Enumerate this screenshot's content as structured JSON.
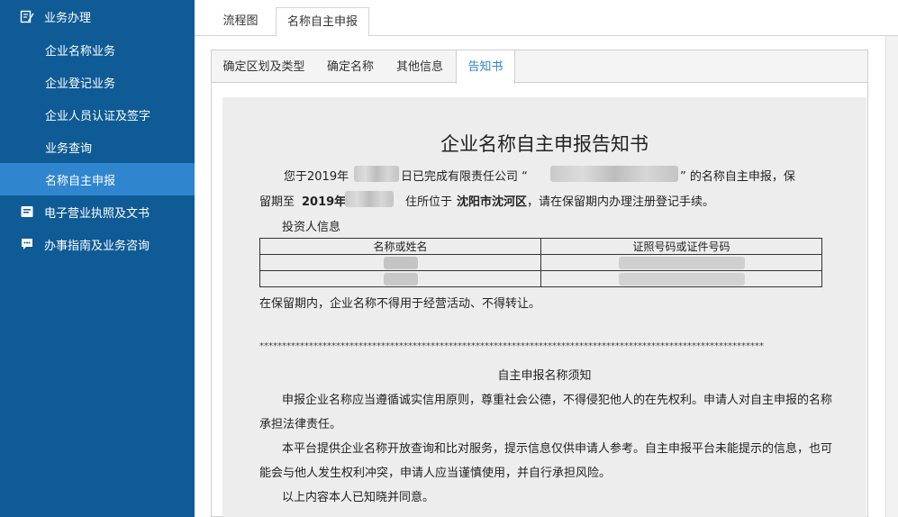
{
  "sidebar": {
    "items": [
      {
        "label": "业务办理",
        "icon": "edit-icon",
        "level": "top"
      },
      {
        "label": "企业名称业务",
        "level": "sub"
      },
      {
        "label": "企业登记业务",
        "level": "sub"
      },
      {
        "label": "企业人员认证及签字",
        "level": "sub"
      },
      {
        "label": "业务查询",
        "level": "sub"
      },
      {
        "label": "名称自主申报",
        "level": "sub",
        "active": true
      },
      {
        "label": "电子营业执照及文书",
        "icon": "license-icon",
        "level": "top"
      },
      {
        "label": "办事指南及业务咨询",
        "icon": "chat-icon",
        "level": "top"
      }
    ]
  },
  "top_tabs": [
    "流程图",
    "名称自主申报"
  ],
  "inner_tabs": [
    "确定区划及类型",
    "确定名称",
    "其他信息",
    "告知书"
  ],
  "notice": {
    "title": "企业名称自主申报告知书",
    "p1_a": "您于2019年",
    "p1_b": "日已完成有限责任公司 “",
    "p1_c": "” 的名称自主申报，保",
    "p2_a": "留期至",
    "p2_b": "2019年",
    "p2_c": "住所位于",
    "p2_d": "沈阳市沈河区",
    "p2_e": "，请在保留期内办理注册登记手续。",
    "investor_label": "投资人信息",
    "table_headers": [
      "名称或姓名",
      "证照号码或证件号码"
    ],
    "restriction": "在保留期内，企业名称不得用于经营活动、不得转让。",
    "separator": "****************************************************************************************************************",
    "sub_title": "自主申报名称须知",
    "para1_l1": "申报企业名称应当遵循诚实信用原则，尊重社会公德，不得侵犯他人的在先权利。申请人对自主申报的名称",
    "para1_l2": "承担法律责任。",
    "para2_l1": "本平台提供企业名称开放查询和比对服务，提示信息仅供申请人参考。自主申报平台未能提示的信息，也可",
    "para2_l2": "能会与他人发生权利冲突，申请人应当谨慎使用，并自行承担风险。",
    "para3": "以上内容本人已知晓并同意。"
  },
  "colors": {
    "sidebar_bg": "#0f5b96",
    "sidebar_active": "#2f86cf",
    "doc_bg": "#ededed",
    "active_tab_text": "#2f86cf"
  }
}
